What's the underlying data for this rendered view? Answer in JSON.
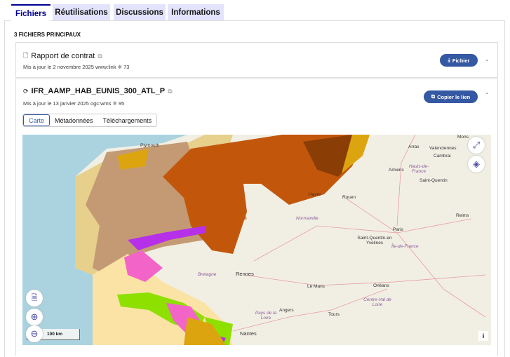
{
  "tabs": [
    {
      "label": "Fichiers",
      "active": true
    },
    {
      "label": "Réutilisations"
    },
    {
      "label": "Discussions"
    },
    {
      "label": "Informations"
    }
  ],
  "section_heading": "3 FICHIERS PRINCIPAUX",
  "files": [
    {
      "title": "Rapport de contrat",
      "icon": "file-icon",
      "meta": "Mis à jour le 2 novembre 2025",
      "format": "www:link",
      "count": "73",
      "button": "Fichier",
      "button_icon": "download-icon",
      "expanded": false
    },
    {
      "title": "IFR_AAMP_HAB_EUNIS_300_ATL_P",
      "icon": "sync-icon",
      "meta": "Mis à jour le 13 janvier 2025",
      "format": "ogc:wms",
      "count": "95",
      "button": "Copier le lien",
      "button_icon": "copy-icon",
      "expanded": true
    }
  ],
  "subtabs": [
    {
      "label": "Carte",
      "active": true
    },
    {
      "label": "Métadonnées"
    },
    {
      "label": "Téléchargements"
    }
  ],
  "map": {
    "scale": "100 km",
    "info": "i",
    "labels": {
      "plymouth": "Plymouth",
      "mons": "Mons",
      "arras": "Arras",
      "valenciennes": "Valenciennes",
      "cambrai": "Cambrai",
      "amiens": "Amiens",
      "hdf": "Hauts-de-France",
      "stq": "Saint-Quentin",
      "rouen": "Rouen",
      "havre": "Havre",
      "normandie": "Normandie",
      "reims": "Reims",
      "paris": "Paris",
      "sqy": "Saint-Quentin-en Yvelines",
      "idf": "Île-de-France",
      "bretagne": "Bretagne",
      "rennes": "Rennes",
      "lemans": "Le Mans",
      "orleans": "Orléans",
      "cvl": "Centre-Val de Loire",
      "angers": "Angers",
      "pdl": "Pays de la Loire",
      "tours": "Tours",
      "nantes": "Nantes"
    },
    "colors": {
      "sea": "#aad3df",
      "land": "#f1efe4",
      "tan": "#c49a74",
      "sand": "#e6d08c",
      "rust": "#c2570c",
      "gold": "#dca510",
      "lightyellow": "#fbe3a6",
      "green": "#8ee000",
      "pink": "#f264c8",
      "purple": "#b530e8"
    }
  }
}
